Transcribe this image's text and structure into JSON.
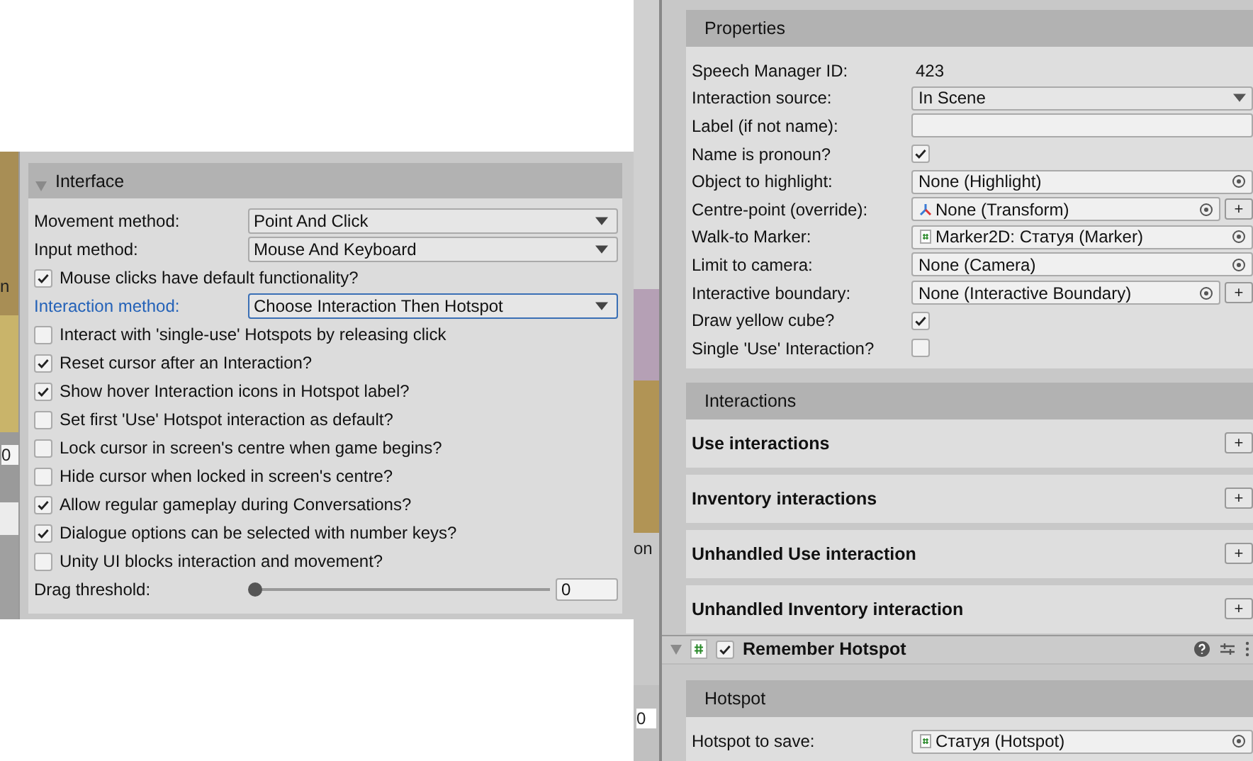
{
  "left_fragments": [
    "n",
    "0"
  ],
  "interface_panel": {
    "title": "Interface",
    "expanded": true,
    "rows": [
      {
        "kind": "dropdown",
        "label": "Movement method:",
        "value": "Point And Click",
        "focused": false
      },
      {
        "kind": "dropdown",
        "label": "Input method:",
        "value": "Mouse And Keyboard",
        "focused": false
      },
      {
        "kind": "checkbox",
        "label": "Mouse clicks have default functionality?",
        "checked": true
      },
      {
        "kind": "dropdown",
        "label": "Interaction method:",
        "value": "Choose Interaction Then Hotspot",
        "focused": true
      },
      {
        "kind": "checkbox",
        "label": "Interact with 'single-use' Hotspots by releasing click",
        "checked": false
      },
      {
        "kind": "checkbox",
        "label": "Reset cursor after an Interaction?",
        "checked": true
      },
      {
        "kind": "checkbox",
        "label": "Show hover Interaction icons in Hotspot label?",
        "checked": true
      },
      {
        "kind": "checkbox",
        "label": "Set first 'Use' Hotspot interaction as default?",
        "checked": false
      },
      {
        "kind": "checkbox",
        "label": "Lock cursor in screen's centre when game begins?",
        "checked": false
      },
      {
        "kind": "checkbox",
        "label": "Hide cursor when locked in screen's centre?",
        "checked": false
      },
      {
        "kind": "checkbox",
        "label": "Allow regular gameplay during Conversations?",
        "checked": true
      },
      {
        "kind": "checkbox",
        "label": "Dialogue options can be selected with number keys?",
        "checked": true
      },
      {
        "kind": "checkbox",
        "label": "Unity UI blocks interaction and movement?",
        "checked": false
      },
      {
        "kind": "slider",
        "label": "Drag threshold:",
        "level": 0,
        "value": "0"
      }
    ]
  },
  "right_fragments": [
    "on",
    "0"
  ],
  "properties": {
    "title": "Properties",
    "rows": [
      {
        "kind": "text",
        "label": "Speech Manager ID:",
        "value": "423"
      },
      {
        "kind": "dropdown",
        "label": "Interaction source:",
        "value": "In Scene"
      },
      {
        "kind": "input",
        "label": "Label (if not name):"
      },
      {
        "kind": "checkbox",
        "label": "Name is pronoun?",
        "checked": true
      },
      {
        "kind": "object",
        "label": "Object to highlight:",
        "value": "None (Highlight)"
      },
      {
        "kind": "transform",
        "label": "Centre-point (override):",
        "value": "None (Transform)",
        "add_label": "+"
      },
      {
        "kind": "marker",
        "label": "Walk-to Marker:",
        "value": "Marker2D: Статуя (Marker)"
      },
      {
        "kind": "object",
        "label": "Limit to camera:",
        "value": "None (Camera)"
      },
      {
        "kind": "object",
        "label": "Interactive boundary:",
        "value": "None (Interactive Boundary)",
        "add_label": "+"
      },
      {
        "kind": "checkbox",
        "label": "Draw yellow cube?",
        "checked": true
      },
      {
        "kind": "checkbox",
        "label": "Single 'Use' Interaction?",
        "checked": false
      }
    ]
  },
  "interactions": {
    "title": "Interactions",
    "items": [
      {
        "label": "Use interactions",
        "add_label": "+"
      },
      {
        "label": "Inventory interactions",
        "add_label": "+"
      },
      {
        "label": "Unhandled Use interaction",
        "add_label": "+"
      },
      {
        "label": "Unhandled Inventory interaction",
        "add_label": "+"
      }
    ]
  },
  "component": {
    "title": "Remember Hotspot",
    "expanded": true,
    "enabled": true
  },
  "hotspot": {
    "title": "Hotspot",
    "rows": [
      {
        "kind": "marker",
        "label": "Hotspot to save:",
        "value": "Статуя (Hotspot)"
      }
    ]
  }
}
